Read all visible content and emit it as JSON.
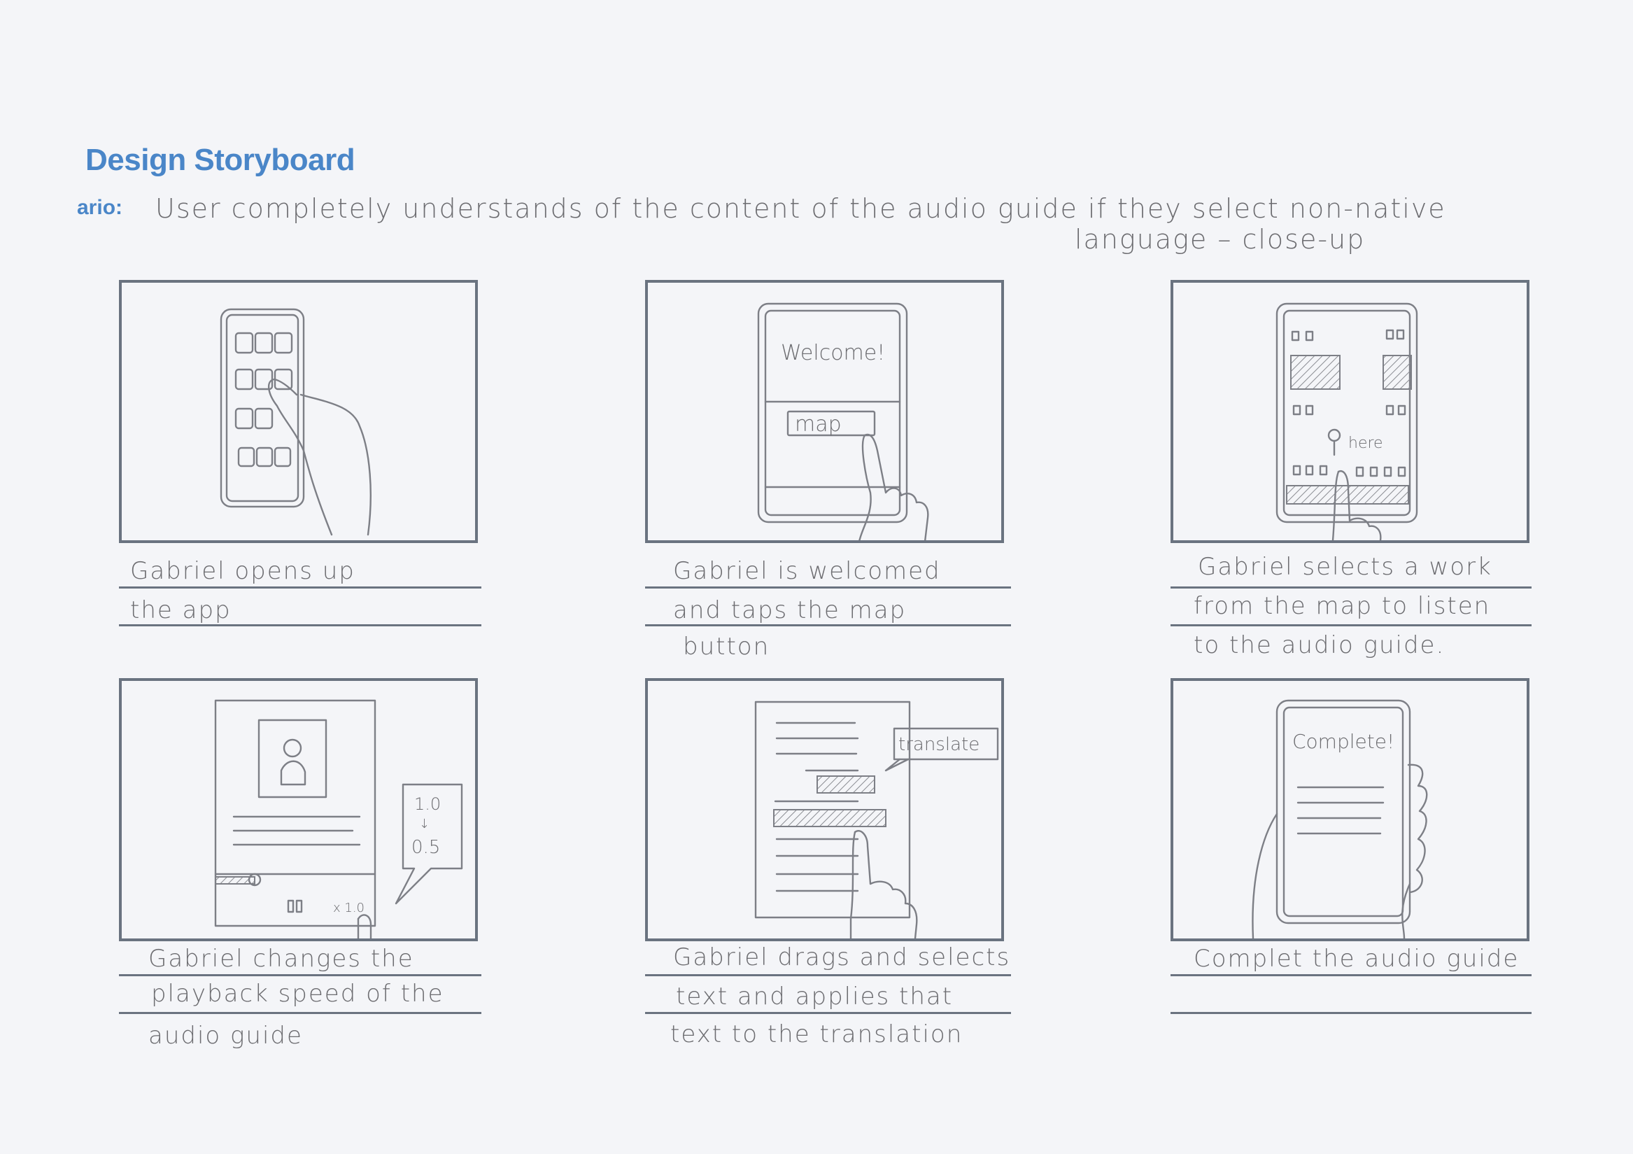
{
  "title": "Design Storyboard",
  "scenario_label": "ario:",
  "scenario_text": {
    "line1": "User completely understands of the content of the audio guide if they select non-native",
    "line2": "language  –  close-up"
  },
  "panels": [
    {
      "captions": [
        "Gabriel opens up",
        "the app"
      ],
      "sketch": {}
    },
    {
      "captions": [
        "Gabriel is welcomed",
        "and taps the map",
        "button"
      ],
      "sketch": {
        "welcome_text": "Welcome!",
        "map_button": "map"
      }
    },
    {
      "captions": [
        "Gabriel selects a work",
        "from the map to listen",
        "to the audio guide."
      ],
      "sketch": {
        "pin_label": "here"
      }
    },
    {
      "captions": [
        "Gabriel changes the",
        "playback speed of the",
        "audio guide"
      ],
      "sketch": {
        "speed_from": "1.0",
        "arrow": "↓",
        "speed_to": "0.5",
        "speed_badge": "x 1.0"
      }
    },
    {
      "captions": [
        "Gabriel drags and selects",
        "text and applies that",
        "text to the translation"
      ],
      "sketch": {
        "translate_label": "translate"
      }
    },
    {
      "captions": [
        "Complet the audio guide"
      ],
      "sketch": {
        "complete_text": "Complete!"
      }
    }
  ]
}
